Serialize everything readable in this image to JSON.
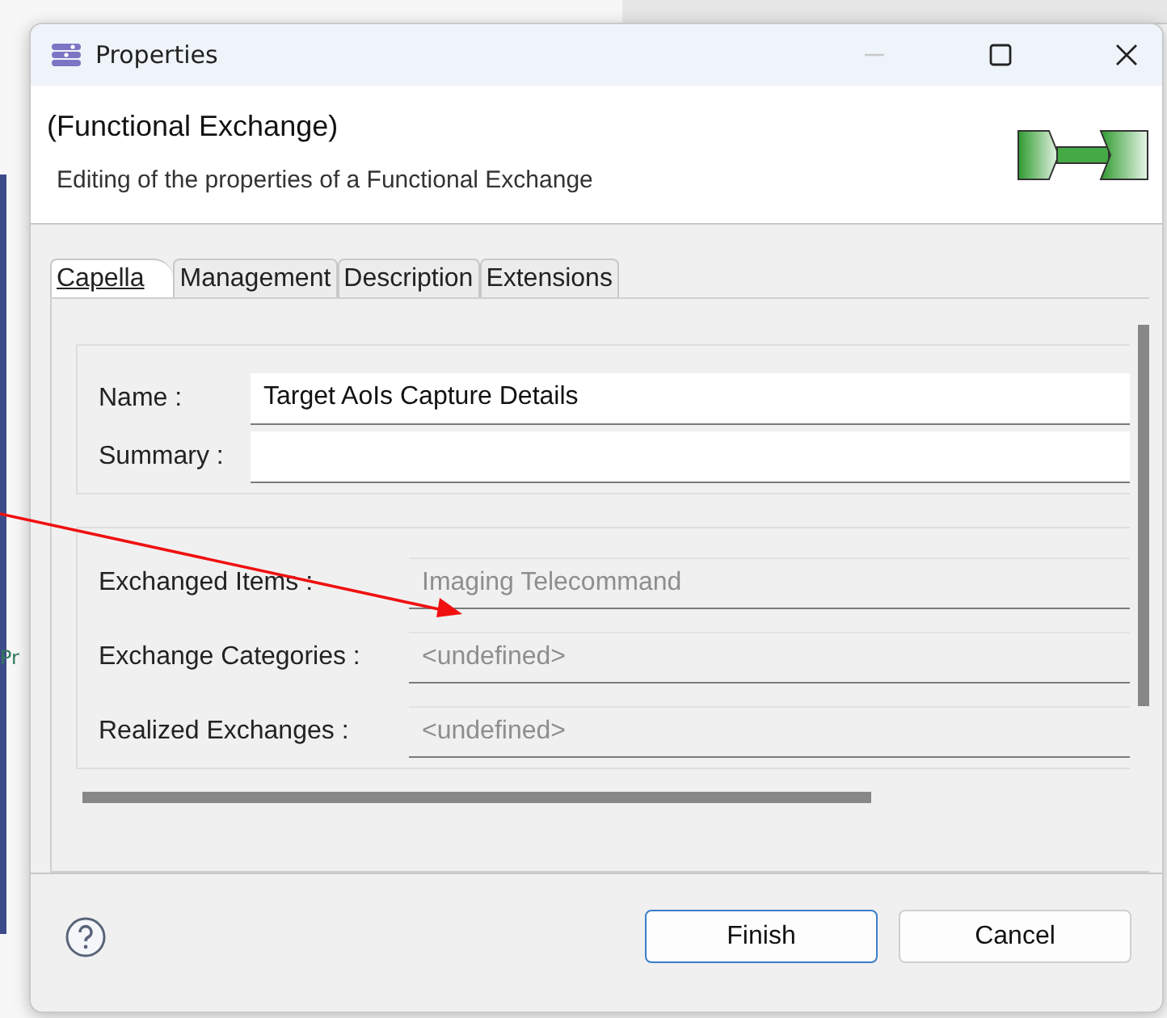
{
  "background": {
    "side_text": "Pr"
  },
  "dialog": {
    "title": "Properties",
    "heading": "(Functional Exchange)",
    "description": "Editing of the properties of a Functional Exchange"
  },
  "tabs": [
    {
      "label": "Capella",
      "selected": true
    },
    {
      "label": "Management",
      "selected": false
    },
    {
      "label": "Description",
      "selected": false
    },
    {
      "label": "Extensions",
      "selected": false
    }
  ],
  "groups": [
    {
      "fields": [
        {
          "label": "Name :",
          "value": "Target AoIs Capture Details",
          "disabled": false
        },
        {
          "label": "Summary :",
          "disabled": false
        }
      ]
    },
    {
      "fields": [
        {
          "label": "Exchanged Items :",
          "value": "Imaging Telecommand",
          "disabled": true
        },
        {
          "label": "Exchange Categories :",
          "value": "<undefined>",
          "disabled": true
        },
        {
          "label": "Realized Exchanges :",
          "value": "<undefined>",
          "disabled": true
        }
      ]
    }
  ],
  "buttons": [
    {
      "label": "Finish",
      "default": true
    },
    {
      "label": "Cancel",
      "default": false
    }
  ]
}
